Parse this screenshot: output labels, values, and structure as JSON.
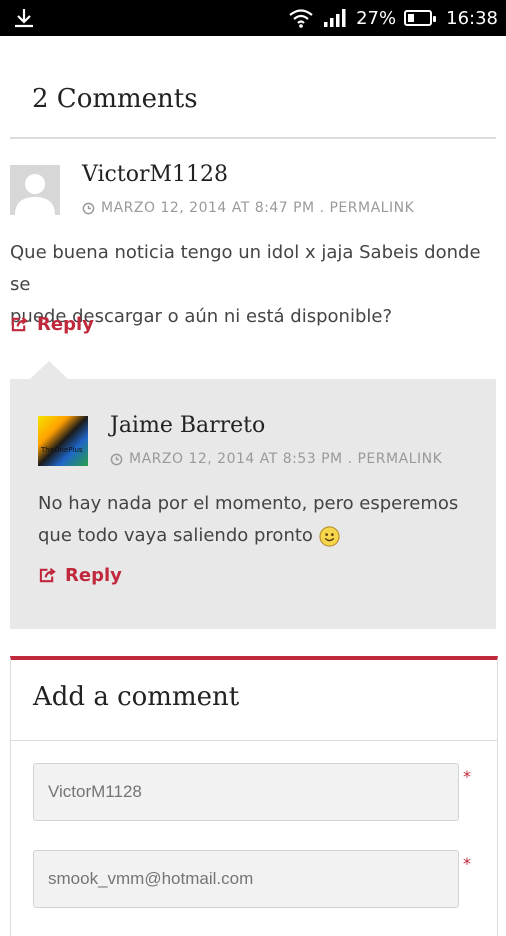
{
  "status_bar": {
    "battery": "27%",
    "battery_level": 0.27,
    "time": "16:38"
  },
  "comments": {
    "title": "2 Comments",
    "items": [
      {
        "author": "VictorM1128",
        "meta": "MARZO 12, 2014 AT 8:47 PM . PERMALINK",
        "text_lines": [
          "Que buena noticia tengo un idol x jaja Sabeis donde se",
          "puede descargar o aún ni está disponible?"
        ],
        "reply_label": "Reply"
      },
      {
        "author": "Jaime Barreto",
        "meta": "MARZO 12, 2014 AT 8:53 PM . PERMALINK",
        "text_lines": [
          "No hay nada por el momento, pero esperemos",
          "que todo vaya saliendo pronto"
        ],
        "reply_label": "Reply",
        "avatar_text": "TheOnePlus"
      }
    ]
  },
  "form": {
    "title": "Add a comment",
    "name_placeholder": "VictorM1128",
    "email_placeholder": "smook_vmm@hotmail.com",
    "required_mark": "*"
  },
  "colors": {
    "accent": "#c0283c",
    "reply_bg": "#e8e8e8",
    "meta": "#9a9a9a"
  }
}
